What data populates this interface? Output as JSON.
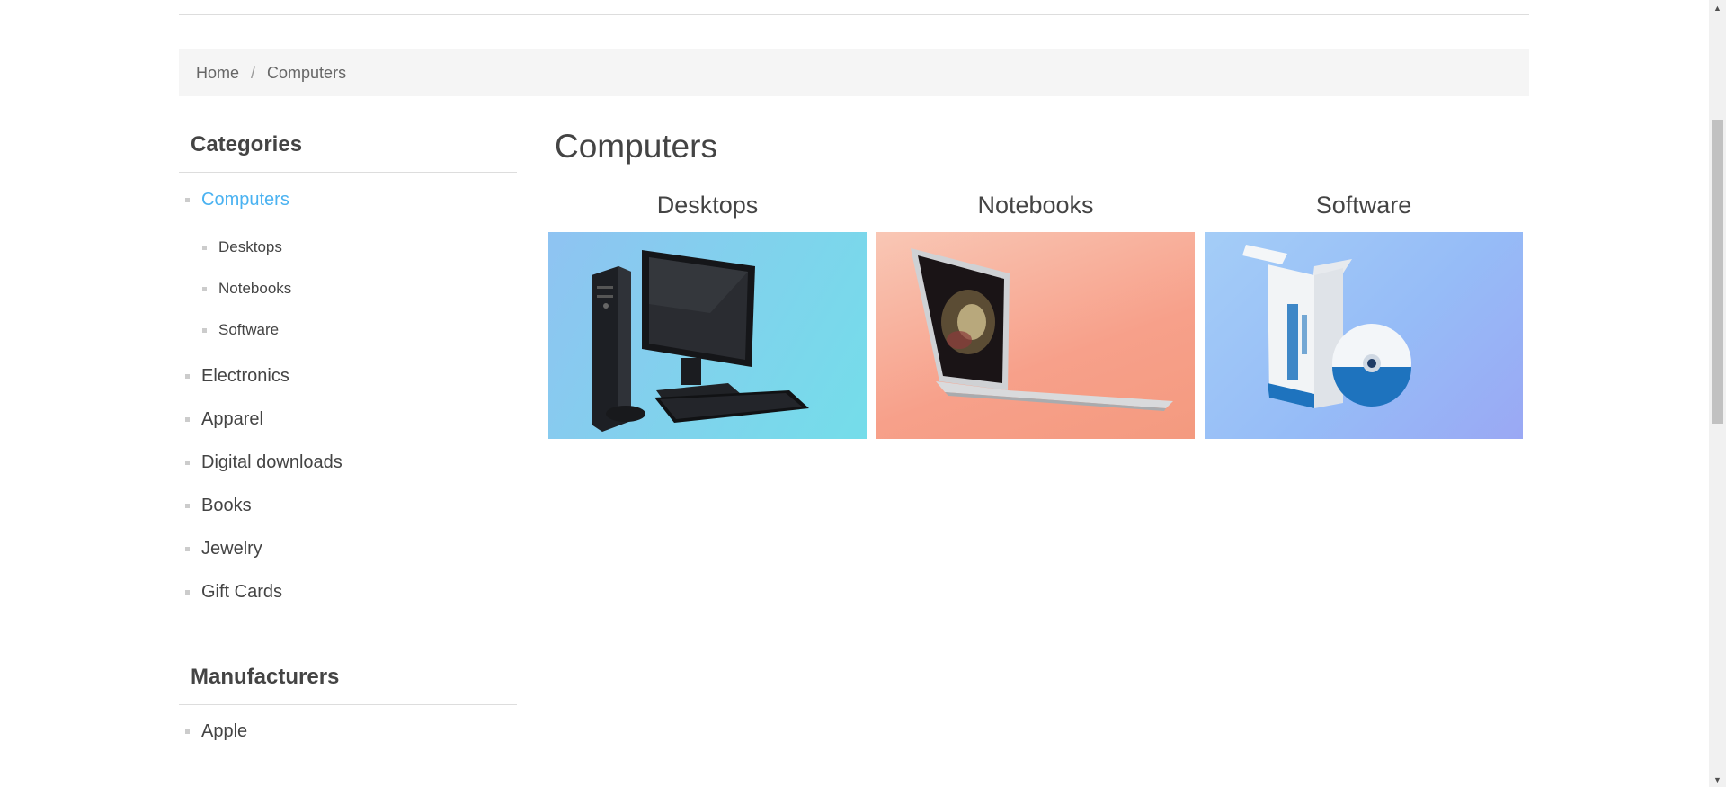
{
  "breadcrumb": {
    "home": "Home",
    "separator": "/",
    "current": "Computers"
  },
  "sidebar": {
    "categories_title": "Categories",
    "categories": [
      {
        "label": "Computers",
        "active": true
      },
      {
        "label": "Electronics"
      },
      {
        "label": "Apparel"
      },
      {
        "label": "Digital downloads"
      },
      {
        "label": "Books"
      },
      {
        "label": "Jewelry"
      },
      {
        "label": "Gift Cards"
      }
    ],
    "subcategories": [
      {
        "label": "Desktops"
      },
      {
        "label": "Notebooks"
      },
      {
        "label": "Software"
      }
    ],
    "manufacturers_title": "Manufacturers",
    "manufacturers": [
      {
        "label": "Apple"
      }
    ]
  },
  "main": {
    "title": "Computers",
    "subcategories": [
      {
        "name": "Desktops",
        "image": "desktop-computer-image"
      },
      {
        "name": "Notebooks",
        "image": "notebook-laptop-image"
      },
      {
        "name": "Software",
        "image": "software-package-image"
      }
    ]
  },
  "colors": {
    "active_link": "#4ab2f1",
    "text": "#444444",
    "breadcrumb_bg": "#f5f5f5",
    "divider": "#dddddd",
    "bullet": "#cccccc"
  },
  "icons": {
    "scroll_up": "▲",
    "scroll_down": "▼"
  }
}
